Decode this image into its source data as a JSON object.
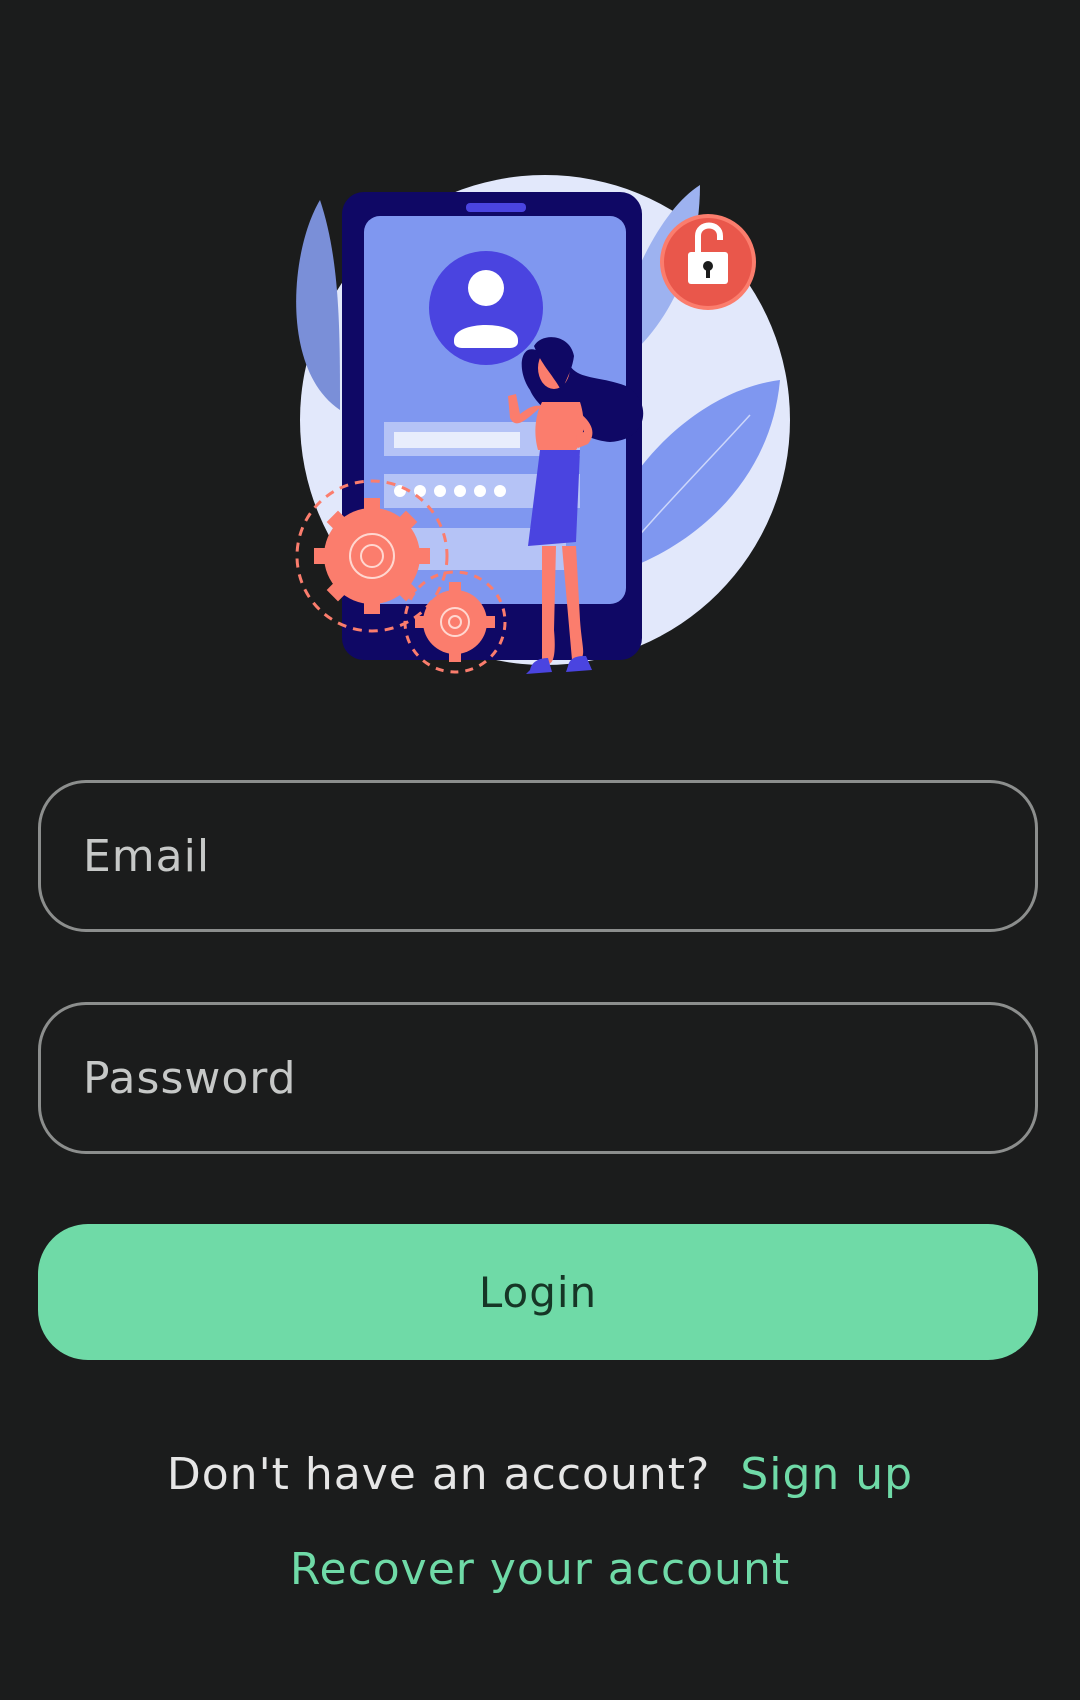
{
  "illustration": {
    "icon": "phone-login-lock-illustration",
    "colors": {
      "blob": "#e2e8fb",
      "phone_body": "#0f0865",
      "phone_screen": "#7f97f0",
      "accent_purple": "#4a44e0",
      "coral": "#fb7d6d",
      "lock_red": "#e9574b"
    }
  },
  "form": {
    "email_placeholder": "Email",
    "password_placeholder": "Password",
    "login_label": "Login"
  },
  "footer": {
    "signup_prompt": "Don't have an account?",
    "signup_link": "Sign up",
    "recover_link": "Recover your account"
  },
  "theme": {
    "background": "#1b1c1c",
    "accent": "#6fdaa7",
    "field_border": "#8c8e8d"
  }
}
